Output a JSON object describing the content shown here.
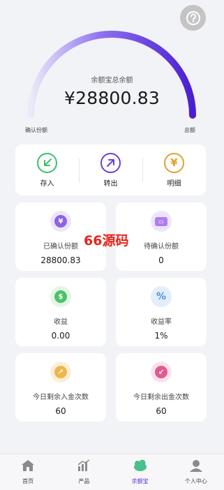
{
  "gauge": {
    "title": "余额宝总余额",
    "amount": "¥28800.83",
    "left_label": "确认份额",
    "right_label": "总额",
    "fraction": 1.0
  },
  "actions": [
    {
      "label": "存入",
      "icon": "deposit-icon",
      "color": "#3cc06a"
    },
    {
      "label": "转出",
      "icon": "withdraw-icon",
      "color": "#6a3fd6"
    },
    {
      "label": "明细",
      "icon": "details-icon",
      "color": "#e0a030"
    }
  ],
  "stats": [
    {
      "label": "已确认份额",
      "value": "28800.83",
      "icon": "confirmed-share-icon"
    },
    {
      "label": "待确认份额",
      "value": "0",
      "icon": "pending-share-icon"
    },
    {
      "label": "收益",
      "value": "0.00",
      "icon": "earnings-icon"
    },
    {
      "label": "收益率",
      "value": "1%",
      "icon": "yield-rate-icon"
    },
    {
      "label": "今日剩余入金次数",
      "value": "60",
      "icon": "deposit-count-icon"
    },
    {
      "label": "今日剩余出金次数",
      "value": "60",
      "icon": "withdraw-count-icon"
    }
  ],
  "watermark": "66源码",
  "tabbar": [
    {
      "label": "首页",
      "icon": "home-icon"
    },
    {
      "label": "产品",
      "icon": "products-icon"
    },
    {
      "label": "余额宝",
      "icon": "yuebao-icon",
      "active": true
    },
    {
      "label": "个人中心",
      "icon": "profile-icon"
    }
  ],
  "colors": {
    "accent": "#5b2fd7",
    "background": "#f2f3f7"
  }
}
